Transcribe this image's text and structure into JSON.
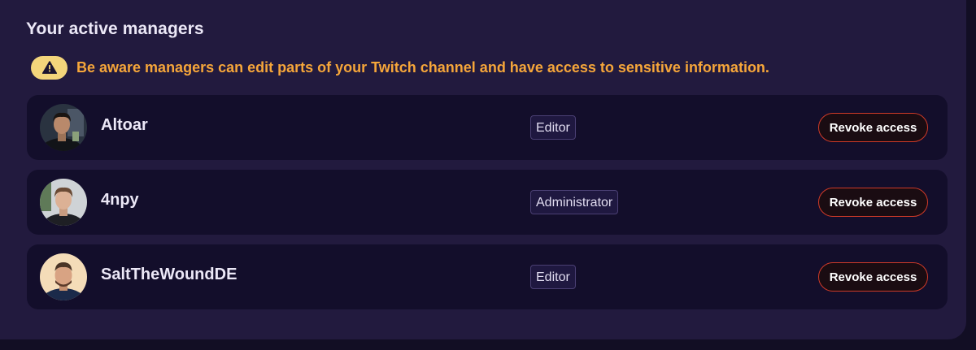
{
  "page": {
    "title": "Your active managers",
    "warning": {
      "icon": "warning-triangle-icon",
      "text": "Be aware managers can edit parts of your Twitch channel and have access to sensitive information."
    }
  },
  "managers": [
    {
      "name": "Altoar",
      "role": "Editor",
      "action_label": "Revoke access"
    },
    {
      "name": "4npy",
      "role": "Administrator",
      "action_label": "Revoke access"
    },
    {
      "name": "SaltTheWoundDE",
      "role": "Editor",
      "action_label": "Revoke access"
    }
  ],
  "colors": {
    "background": "#221a3e",
    "row_background": "#130e2b",
    "warning_text": "#f6a63a",
    "warning_pill": "#f3d57b",
    "revoke_border": "#cf3a28",
    "badge_border": "#4a3f73"
  }
}
